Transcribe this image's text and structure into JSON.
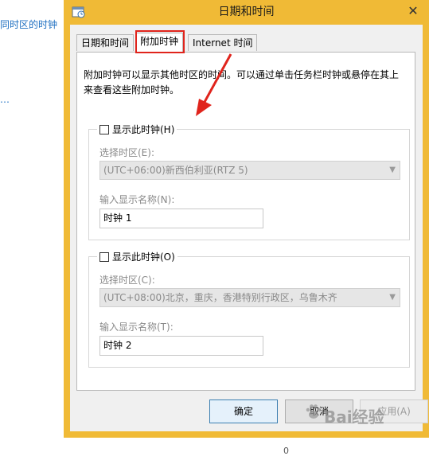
{
  "background": {
    "link_text": "同时区的时钟",
    "link_text_2": "…",
    "bottom_text": "0"
  },
  "dialog": {
    "title": "日期和时间",
    "close_symbol": "✕"
  },
  "tabs": [
    {
      "label": "日期和时间",
      "active": false
    },
    {
      "label": "附加时钟",
      "active": true
    },
    {
      "label": "Internet 时间",
      "active": false
    }
  ],
  "description": "附加时钟可以显示其他时区的时间。可以通过单击任务栏时钟或悬停在其上来查看这些附加时钟。",
  "clock1": {
    "show_label": "显示此时钟(H)",
    "checked": false,
    "timezone_label": "选择时区(E):",
    "timezone_value": "(UTC+06:00)新西伯利亚(RTZ 5)",
    "name_label": "输入显示名称(N):",
    "name_value": "时钟 1"
  },
  "clock2": {
    "show_label": "显示此时钟(O)",
    "checked": false,
    "timezone_label": "选择时区(C):",
    "timezone_value": "(UTC+08:00)北京，重庆，香港特别行政区，乌鲁木齐",
    "name_label": "输入显示名称(T):",
    "name_value": "时钟 2"
  },
  "buttons": {
    "ok": "确定",
    "cancel": "取消",
    "apply": "应用(A)"
  },
  "watermark": {
    "text": "Bai经验"
  },
  "icons": {
    "app": "clock-icon",
    "dropdown": "chevron-down-icon",
    "annotation": "red-arrow-icon"
  },
  "colors": {
    "window_frame": "#f0ba36",
    "highlight": "#e0241c",
    "link": "#1e6fc1"
  }
}
